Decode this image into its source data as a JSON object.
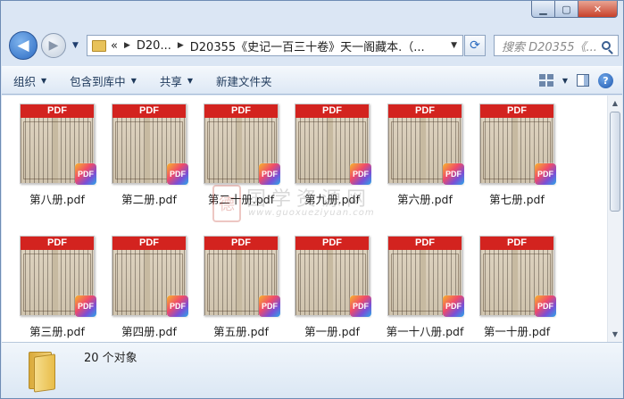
{
  "window": {
    "caption": {
      "minimize": "▁",
      "maximize": "▢",
      "close": "✕"
    }
  },
  "nav": {
    "back_glyph": "◀",
    "forward_glyph": "▶",
    "breadcrumbs": [
      "«",
      "D20...",
      "D20355《史记一百三十卷》天一阁藏本.（..."
    ],
    "search_placeholder": "搜索 D20355《..."
  },
  "toolbar": {
    "organize": "组织",
    "include_in_library": "包含到库中",
    "share": "共享",
    "new_folder": "新建文件夹"
  },
  "files": [
    {
      "name": "第八册.pdf",
      "band": "PDF",
      "badge": "PDF"
    },
    {
      "name": "第二册.pdf",
      "band": "PDF",
      "badge": "PDF"
    },
    {
      "name": "第二十册.pdf",
      "band": "PDF",
      "badge": "PDF"
    },
    {
      "name": "第九册.pdf",
      "band": "PDF",
      "badge": "PDF"
    },
    {
      "name": "第六册.pdf",
      "band": "PDF",
      "badge": "PDF"
    },
    {
      "name": "第七册.pdf",
      "band": "PDF",
      "badge": "PDF"
    },
    {
      "name": "第三册.pdf",
      "band": "PDF",
      "badge": "PDF"
    },
    {
      "name": "第四册.pdf",
      "band": "PDF",
      "badge": "PDF"
    },
    {
      "name": "第五册.pdf",
      "band": "PDF",
      "badge": "PDF"
    },
    {
      "name": "第一册.pdf",
      "band": "PDF",
      "badge": "PDF"
    },
    {
      "name": "第一十八册.pdf",
      "band": "PDF",
      "badge": "PDF"
    },
    {
      "name": "第一十册.pdf",
      "band": "PDF",
      "badge": "PDF"
    }
  ],
  "watermark": {
    "seal": "德",
    "title": "国学资源网",
    "url": "www.guoxueziyuan.com"
  },
  "status": {
    "item_count": "20 个对象"
  },
  "colors": {
    "pdf_band": "#d3231f",
    "window_frame": "#dbe6f4"
  }
}
